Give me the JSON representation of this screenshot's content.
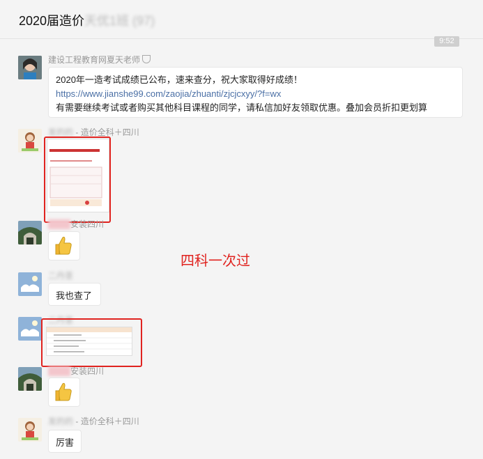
{
  "header": {
    "title": "2020届造价",
    "title_blurred": "天优1班 (97)"
  },
  "time_label": "9:52",
  "messages": [
    {
      "name": "建设工程教育网夏天老师",
      "lines": [
        "2020年一造考试成绩已公布，速来查分，祝大家取得好成绩！",
        "https://www.jianshe99.com/zaojia/zhuanti/zjcjcxyy/?f=wx",
        "有需要继续考试或者购买其他科目课程的同学，请私信加好友领取优惠。叠加会员折扣更划算"
      ]
    },
    {
      "name_blurred": "发的的",
      "name_suffix": "- 造价全科＋四川"
    },
    {
      "name_blurred": "安装四川"
    },
    {
      "name_blurred": "二丹茎"
    },
    {
      "text": "我也查了"
    },
    {
      "name_blurred": "二丹茎"
    },
    {
      "name_blurred": "安装四川"
    },
    {
      "name_blurred": "发的的",
      "name_suffix": "- 造价全科＋四川",
      "text": "厉害"
    }
  ],
  "annotation": "四科一次过",
  "colors": {
    "annotation": "#e0231f",
    "link": "#4a6fa5",
    "background": "#f4f4f4"
  }
}
